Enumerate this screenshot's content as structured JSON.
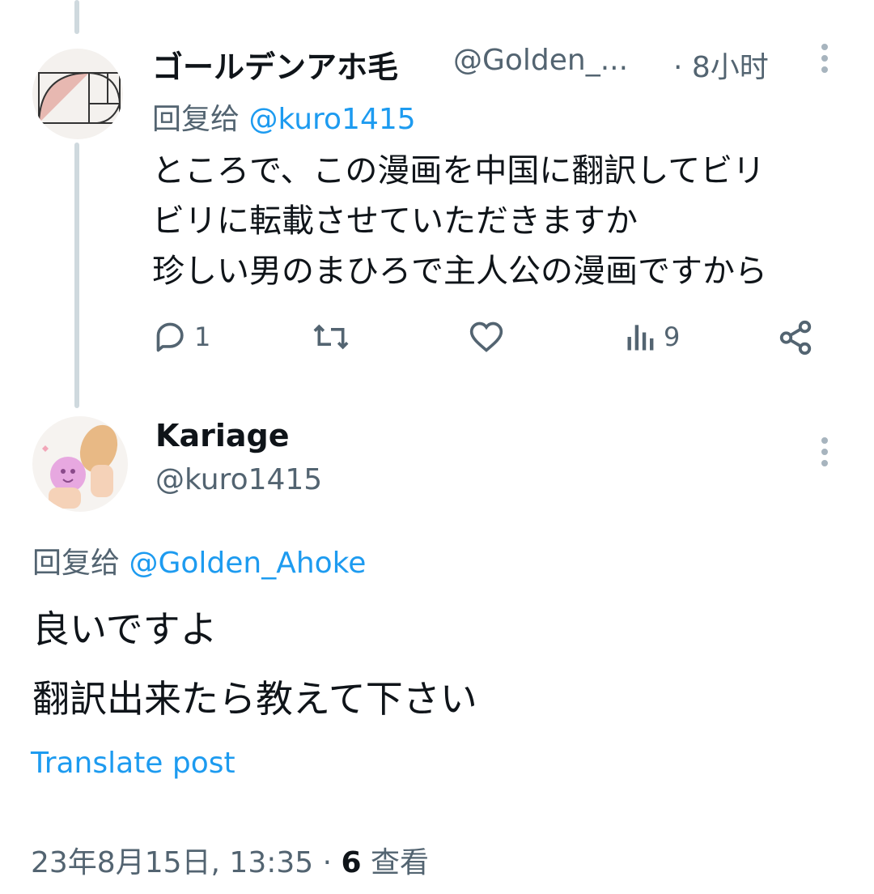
{
  "tweet1": {
    "display_name": "ゴールデンアホ毛",
    "handle": "@Golden_...",
    "time": "· 8小时",
    "reply_prefix": "回复给",
    "reply_to": "@kuro1415",
    "text_lines": [
      "ところで、この漫画を中国に翻訳してビリ",
      "ビリに転載させていただきますか",
      "珍しい男のまひろで主人公の漫画ですから"
    ],
    "actions": {
      "replies": "1",
      "views": "9"
    }
  },
  "tweet2": {
    "display_name": "Kariage",
    "handle": "@kuro1415",
    "reply_prefix": "回复给",
    "reply_to": "@Golden_Ahoke",
    "text_lines": [
      "良いですよ",
      "翻訳出来たら教えて下さい"
    ],
    "translate_label": "Translate post",
    "timestamp": "23年8月15日, 13:35 ·",
    "views_count": "6",
    "views_label": "查看"
  },
  "icons": [
    "reply-icon",
    "retweet-icon",
    "like-icon",
    "views-icon",
    "share-icon",
    "more-icon"
  ],
  "colors": {
    "link": "#1d9bf0",
    "secondary": "#536471",
    "thread_line": "#cfd9de"
  }
}
